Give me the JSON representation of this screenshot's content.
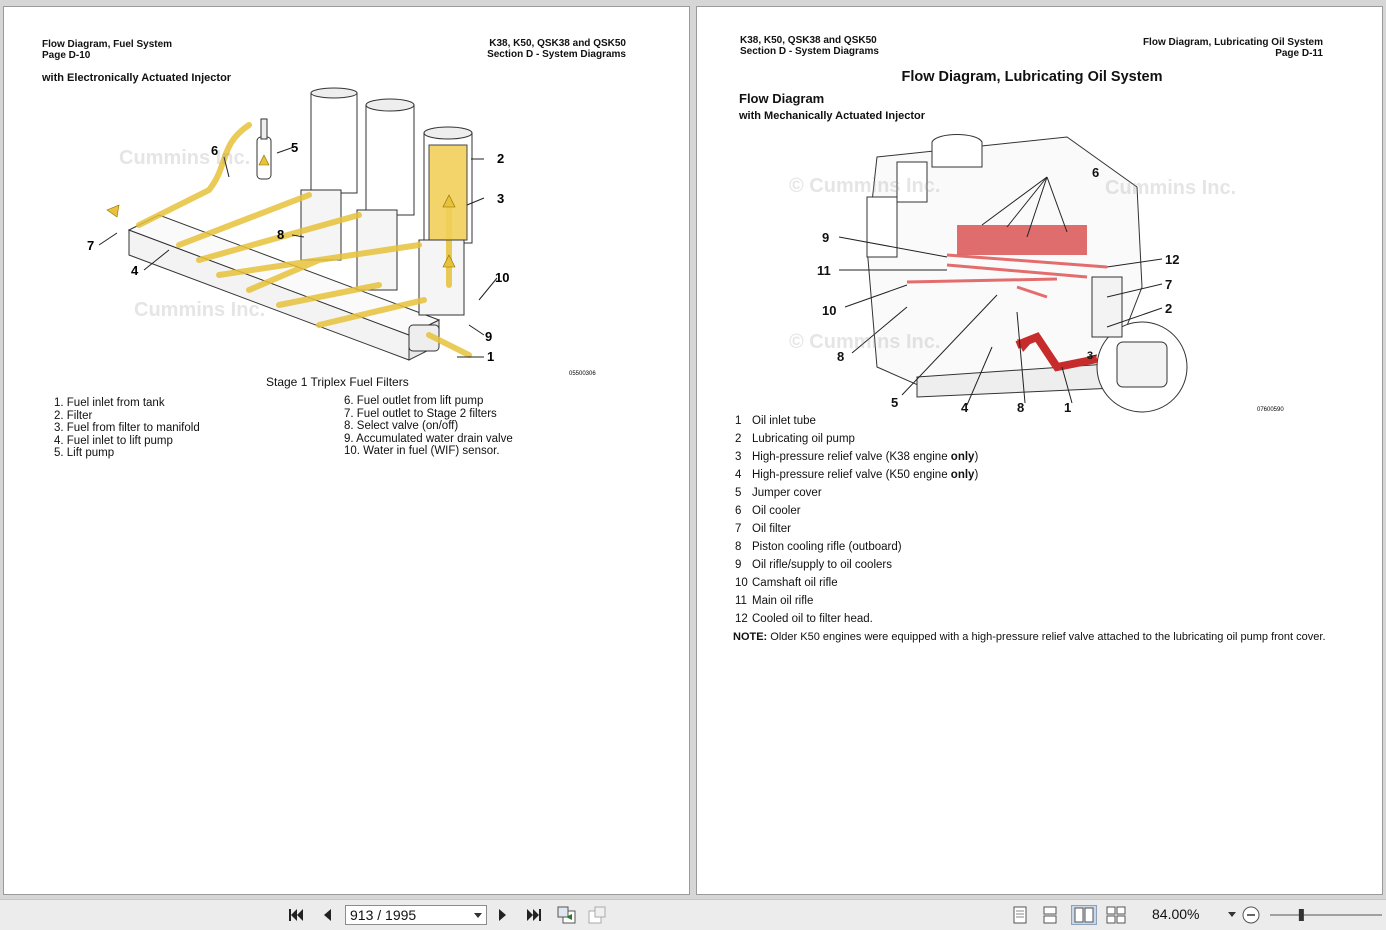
{
  "left_page": {
    "header_left_line1": "Flow Diagram, Fuel System",
    "header_left_line2": "Page D-10",
    "header_right_line1": "K38, K50, QSK38 and QSK50",
    "header_right_line2": "Section D - System Diagrams",
    "subtitle": "with Electronically Actuated Injector",
    "figure_caption": "Stage 1 Triplex Fuel Filters",
    "figure_id": "05500306",
    "watermark": "Cummins Inc.",
    "callouts": [
      "1",
      "2",
      "3",
      "4",
      "5",
      "6",
      "7",
      "8",
      "9",
      "10"
    ],
    "legend_left": [
      "1.  Fuel inlet from tank",
      "2.  Filter",
      "3.  Fuel from filter to manifold",
      "4.  Fuel inlet to lift pump",
      "5.  Lift pump"
    ],
    "legend_right": [
      "6.   Fuel outlet from lift pump",
      "7.   Fuel outlet to Stage 2 filters",
      "8.   Select valve (on/off)",
      "9.   Accumulated water drain valve",
      "10.  Water in fuel (WIF) sensor."
    ]
  },
  "right_page": {
    "header_left_line1": "K38, K50, QSK38 and QSK50",
    "header_left_line2": "Section D - System Diagrams",
    "header_right_line1": "Flow Diagram, Lubricating Oil System",
    "header_right_line2": "Page D-11",
    "title": "Flow Diagram, Lubricating Oil System",
    "section_heading": "Flow Diagram",
    "subtitle": "with Mechanically Actuated Injector",
    "figure_id": "07600590",
    "watermark": "© Cummins Inc.",
    "watermark2": "Cummins Inc.",
    "callouts": [
      "1",
      "2",
      "3",
      "4",
      "5",
      "6",
      "7",
      "8",
      "9",
      "10",
      "11",
      "12"
    ],
    "legend": [
      {
        "num": "1",
        "text": "Oil inlet tube",
        "bold": ""
      },
      {
        "num": "2",
        "text": "Lubricating oil pump",
        "bold": ""
      },
      {
        "num": "3",
        "text": "High-pressure relief valve (K38 engine ",
        "bold": "only",
        "tail": ")"
      },
      {
        "num": "4",
        "text": "High-pressure relief valve (K50 engine ",
        "bold": "only",
        "tail": ")"
      },
      {
        "num": "5",
        "text": "Jumper cover",
        "bold": ""
      },
      {
        "num": "6",
        "text": "Oil cooler",
        "bold": ""
      },
      {
        "num": "7",
        "text": "Oil filter",
        "bold": ""
      },
      {
        "num": "8",
        "text": "Piston cooling rifle (outboard)",
        "bold": ""
      },
      {
        "num": "9",
        "text": "Oil rifle/supply to oil coolers",
        "bold": ""
      },
      {
        "num": "10",
        "text": "Camshaft oil rifle",
        "bold": ""
      },
      {
        "num": "11",
        "text": "Main oil rifle",
        "bold": ""
      },
      {
        "num": "12",
        "text": "Cooled oil to filter head.",
        "bold": ""
      }
    ],
    "note_label": "NOTE:",
    "note_text": " Older K50 engines were equipped with a high-pressure relief valve attached to the lubricating oil pump front cover."
  },
  "toolbar": {
    "page_input_value": "913 / 1995",
    "zoom_value": "84.00%",
    "zoom_slider_fraction": 0.28,
    "icons": [
      "first-page-icon",
      "previous-page-icon",
      "next-page-icon",
      "last-page-icon",
      "go-back-view-icon",
      "go-forward-view-icon",
      "single-page-view-icon",
      "continuous-page-view-icon",
      "facing-pages-view-icon",
      "continuous-facing-view-icon",
      "zoom-out-icon"
    ]
  }
}
